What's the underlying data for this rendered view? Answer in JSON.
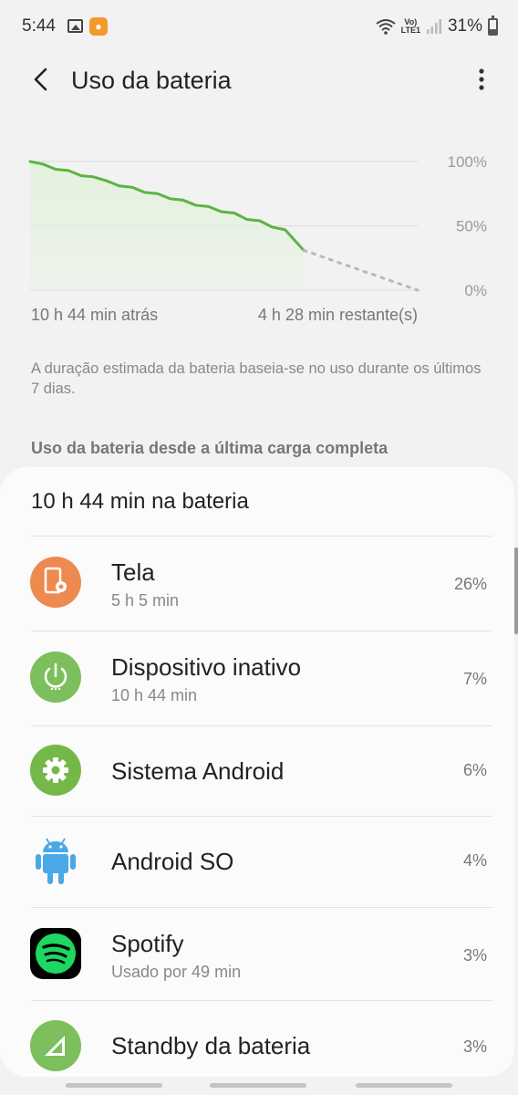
{
  "status_bar": {
    "time": "5:44",
    "volte": "VoLTE1",
    "battery": "31%"
  },
  "app_bar": {
    "title": "Uso da bateria",
    "back_icon": "arrow-back-icon",
    "more_icon": "more-vert-icon"
  },
  "chart_data": {
    "type": "line",
    "y_ticks": [
      "100%",
      "50%",
      "0%"
    ],
    "ylim": [
      0,
      100
    ],
    "x_start_label": "10 h 44 min atrás",
    "x_end_label": "4 h 28 min restante(s)",
    "elapsed_hours": 10.73,
    "remaining_hours": 4.47,
    "series": [
      {
        "points": [
          [
            0,
            100
          ],
          [
            0.5,
            98
          ],
          [
            1.0,
            94
          ],
          [
            1.5,
            93
          ],
          [
            2.0,
            89
          ],
          [
            2.5,
            88
          ],
          [
            3.0,
            85
          ],
          [
            3.5,
            81
          ],
          [
            4.0,
            80
          ],
          [
            4.5,
            76
          ],
          [
            5.0,
            75
          ],
          [
            5.5,
            71
          ],
          [
            6.0,
            70
          ],
          [
            6.5,
            66
          ],
          [
            7.0,
            65
          ],
          [
            7.5,
            61
          ],
          [
            8.0,
            60
          ],
          [
            8.5,
            55
          ],
          [
            9.0,
            54
          ],
          [
            9.5,
            49
          ],
          [
            10.0,
            47
          ],
          [
            10.73,
            31
          ]
        ]
      }
    ],
    "projection": [
      [
        10.73,
        31
      ],
      [
        15.2,
        0
      ]
    ],
    "colors": {
      "line": "#5cb443",
      "fill": "#e4f2de",
      "projection": "#b8b8b8",
      "grid": "#dcdcdc"
    }
  },
  "estimate_note": "A duração estimada da bateria baseia-se no uso durante os últimos 7 dias.",
  "section_header": "Uso da bateria desde a última carga completa",
  "summary": "10 h 44 min na bateria",
  "apps": [
    {
      "name": "Tela",
      "sub": "5 h 5 min",
      "percent": "26%",
      "icon": "screen-icon",
      "color": "#ee8a4f"
    },
    {
      "name": "Dispositivo inativo",
      "sub": "10 h 44 min",
      "percent": "7%",
      "icon": "power-icon",
      "color": "#7cbf5c"
    },
    {
      "name": "Sistema Android",
      "sub": "",
      "percent": "6%",
      "icon": "gear-icon",
      "color": "#75b84a"
    },
    {
      "name": "Android SO",
      "sub": "",
      "percent": "4%",
      "icon": "android-icon",
      "color": "#4aa8e6"
    },
    {
      "name": "Spotify",
      "sub": "Usado por 49 min",
      "percent": "3%",
      "icon": "spotify-icon",
      "color": "#1ed760"
    },
    {
      "name": "Standby da bateria",
      "sub": "",
      "percent": "3%",
      "icon": "signal-icon",
      "color": "#7cbf5c"
    }
  ]
}
